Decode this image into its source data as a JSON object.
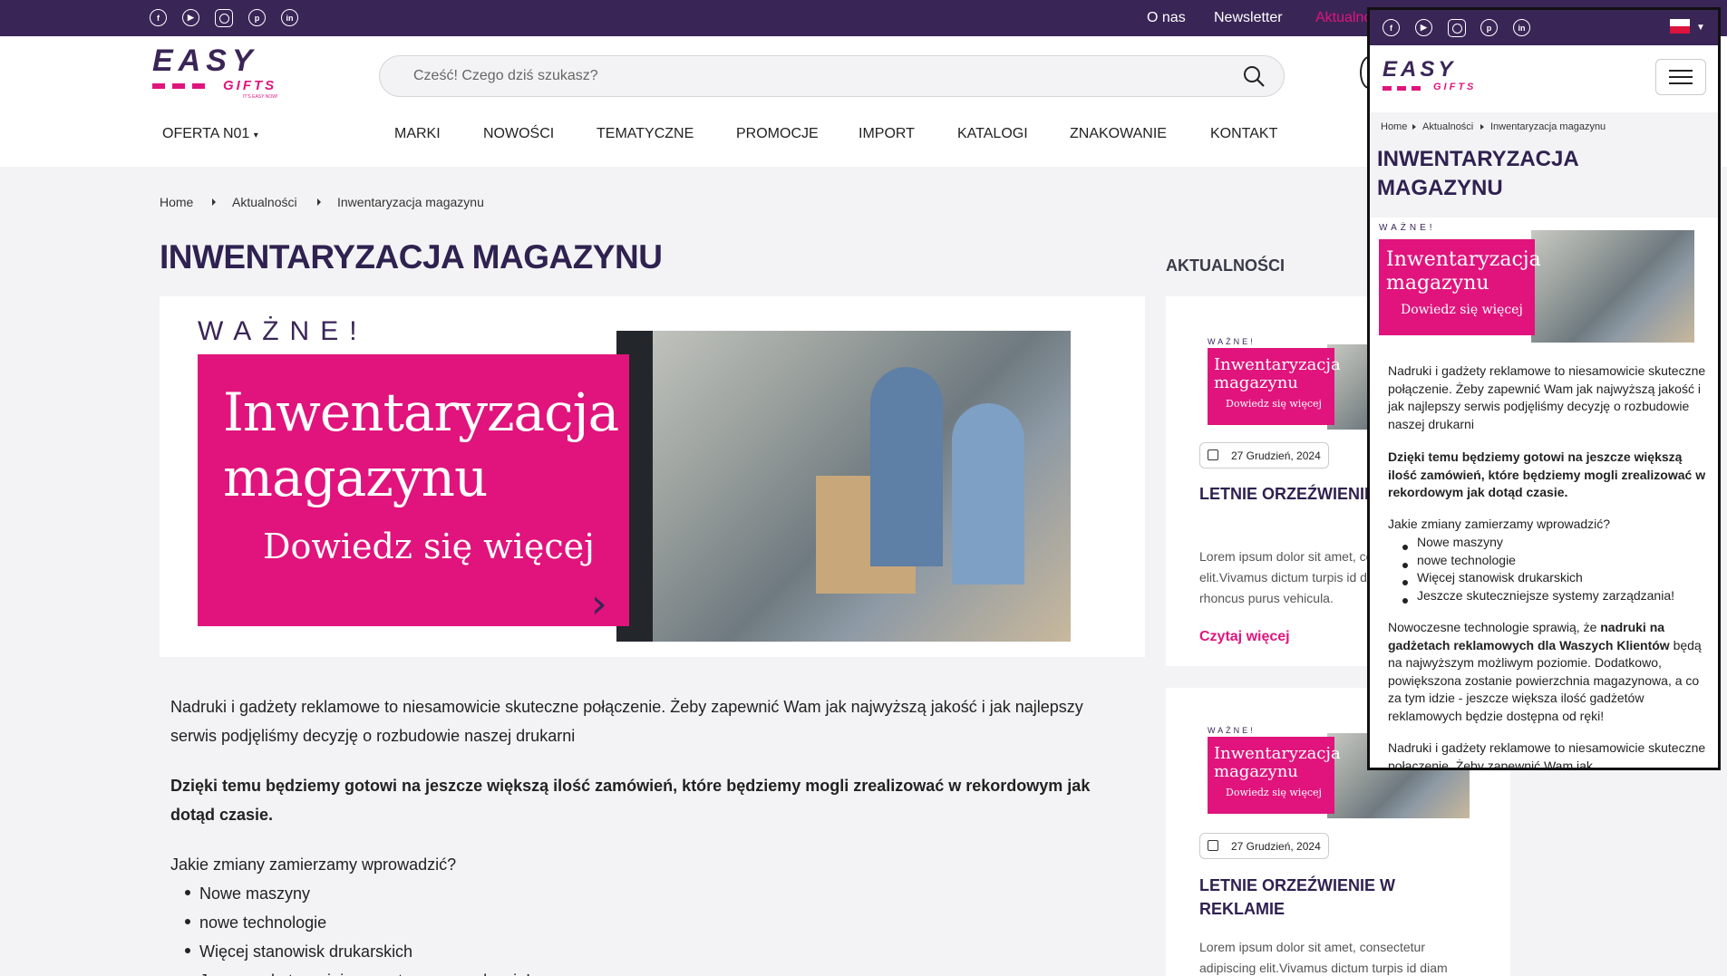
{
  "topbar": {
    "links": [
      "O nas",
      "Newsletter",
      "Aktualności"
    ],
    "social_icons": [
      "facebook-icon",
      "youtube-icon",
      "instagram-icon",
      "pinterest-icon",
      "linkedin-icon"
    ],
    "bg_color": "#3a2557",
    "active_color": "#e0157c"
  },
  "logo": {
    "main": "EASY",
    "sub": "GIFTS",
    "tagline": "IT'S EASY NOW!"
  },
  "search": {
    "placeholder": "Cześć!  Czego dziś szukasz?"
  },
  "nav": {
    "dropdown": "OFERTA N01",
    "items": [
      "MARKI",
      "NOWOŚCI",
      "TEMATYCZNE",
      "PROMOCJE",
      "IMPORT",
      "KATALOGI",
      "ZNAKOWANIE",
      "KONTAKT"
    ]
  },
  "breadcrumb": [
    "Home",
    "Aktualności",
    "Inwentaryzacja magazynu"
  ],
  "page_title": "INWENTARYZACJA MAGAZYNU",
  "banner": {
    "tag": "WAŻNE!",
    "line1": "Inwentaryzacja",
    "line2": "magazynu",
    "line3": "Dowiedz się więcej"
  },
  "article": {
    "p1": "Nadruki i gadżety reklamowe to niesamowicie skuteczne połączenie. Żeby zapewnić Wam jak najwyższą jakość i jak najlepszy serwis podjęliśmy decyzję o rozbudowie naszej drukarni",
    "p2": "Dzięki temu będziemy gotowi na jeszcze większą ilość zamówień, które będziemy mogli zrealizować w rekordowym jak dotąd czasie.",
    "p3": "Jakie zmiany zamierzamy wprowadzić?",
    "list": [
      "Nowe maszyny",
      "nowe technologie",
      "Więcej stanowisk drukarskich",
      "Jeszcze skuteczniejsze systemy zarządzania!"
    ],
    "p4_a": "Nowoczesne technologie sprawią, że ",
    "p4_b": "nadruki na gadżetach reklamowych dla Waszych Klientów",
    "p4_c": " będą na najwyższym możliwym poziomie. Dodatkowo, powiększona zostanie powierzchnia magazynowa, a co za tym idzie - jeszcze większa ilość gadżetów reklamowych będzie dostępna od ręki!",
    "p5": "Nadruki i gadżety reklamowe to niesamowicie skuteczne połączenie. Żeby zapewnić Wam jak"
  },
  "sidebar": {
    "heading": "AKTUALNOŚCI",
    "cards": [
      {
        "date": "27 Grudzień, 2024",
        "title": "LETNIE ORZEŹWIENIE W REKLAMIE",
        "lorem": "Lorem ipsum dolor sit amet, consectetur adipiscing elit.Vivamus dictum turpis id diam accumsan, ut rhoncus purus vehicula.",
        "more": "Czytaj więcej"
      },
      {
        "date": "27 Grudzień, 2024",
        "title": "LETNIE ORZEŹWIENIE W REKLAMIE",
        "lorem": "Lorem ipsum dolor sit amet, consectetur adipiscing elit.Vivamus dictum turpis id diam"
      }
    ]
  },
  "mobile": {
    "title_line1": "INWENTARYZACJA",
    "title_line2": "MAGAZYNU",
    "menu_icon": "hamburger-icon",
    "flag_icon": "poland-flag-icon"
  }
}
